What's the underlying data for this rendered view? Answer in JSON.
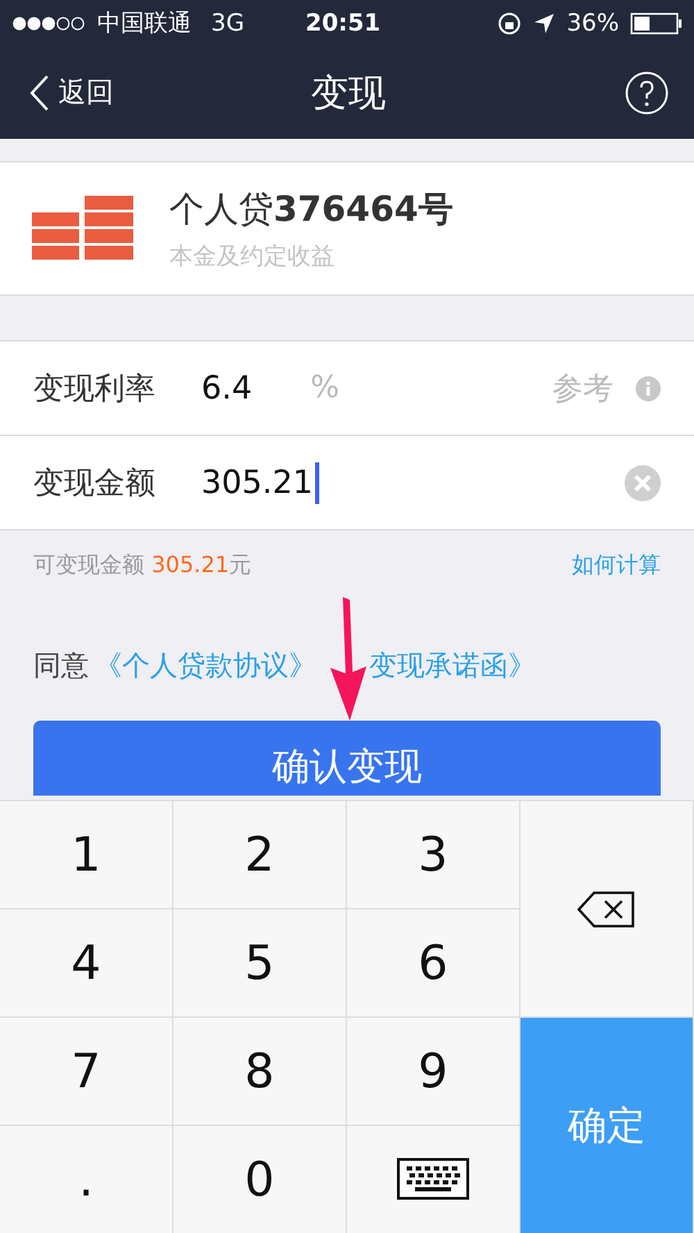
{
  "status_bar": {
    "carrier": "中国联通",
    "network": "3G",
    "time": "20:51",
    "battery": "36%"
  },
  "nav": {
    "back": "返回",
    "title": "变现"
  },
  "product": {
    "name": "个人贷",
    "number": "376464号",
    "subtitle": "本金及约定收益"
  },
  "fields": [
    {
      "kind": "rate",
      "label": "变现利率",
      "value": "6.4",
      "unit": "%",
      "hint": "参考"
    },
    {
      "kind": "amount",
      "label": "变现金额",
      "value": "305.21",
      "focused": true
    }
  ],
  "available": {
    "label": "可变现金额",
    "amount": "305.21",
    "unit": "元",
    "link": "如何计算"
  },
  "agreement": {
    "prefix": "同意",
    "links": [
      "《个人贷款协议》",
      "变现承诺函》"
    ]
  },
  "confirm_button": "确认变现",
  "keyboard": [
    {
      "kind": "digit",
      "label": "1"
    },
    {
      "kind": "digit",
      "label": "2"
    },
    {
      "kind": "digit",
      "label": "3"
    },
    {
      "kind": "delete"
    },
    {
      "kind": "digit",
      "label": "4"
    },
    {
      "kind": "digit",
      "label": "5"
    },
    {
      "kind": "digit",
      "label": "6"
    },
    {
      "kind": "digit",
      "label": "7"
    },
    {
      "kind": "digit",
      "label": "8"
    },
    {
      "kind": "digit",
      "label": "9"
    },
    {
      "kind": "confirm",
      "label": "确定"
    },
    {
      "kind": "digit",
      "label": "."
    },
    {
      "kind": "digit",
      "label": "0"
    },
    {
      "kind": "hide"
    }
  ]
}
